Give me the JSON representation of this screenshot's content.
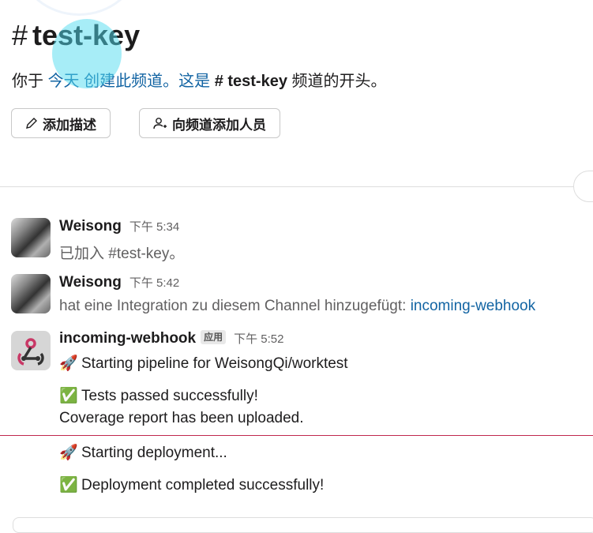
{
  "header": {
    "hash": "#",
    "channel_name": "test-key"
  },
  "intro": {
    "part1": "你于",
    "today": "今天",
    "part2": "创建此频道。这是",
    "channel_ref": "# test-key",
    "part3": "频道的开头。"
  },
  "buttons": {
    "add_description": "添加描述",
    "add_people": "向频道添加人员"
  },
  "messages": [
    {
      "author": "Weisong",
      "time": "下午 5:34",
      "text": "已加入 #test-key。"
    },
    {
      "author": "Weisong",
      "time": "下午 5:42",
      "text": "hat eine Integration zu diesem Channel hinzugefügt:",
      "link": "incoming-webhook"
    },
    {
      "author": "incoming-webhook",
      "badge": "应用",
      "time": "下午 5:52",
      "lines": [
        {
          "emoji": "🚀",
          "text": "Starting pipeline for WeisongQi/worktest"
        },
        {
          "emoji": "✅",
          "text": "Tests passed successfully!"
        },
        {
          "emoji": "",
          "text": "Coverage report has been uploaded."
        },
        {
          "emoji": "🚀",
          "text": "Starting deployment..."
        },
        {
          "emoji": "✅",
          "text": "Deployment completed successfully!"
        }
      ]
    }
  ],
  "colors": {
    "link": "#1264a3",
    "new_divider": "#c0284e"
  }
}
